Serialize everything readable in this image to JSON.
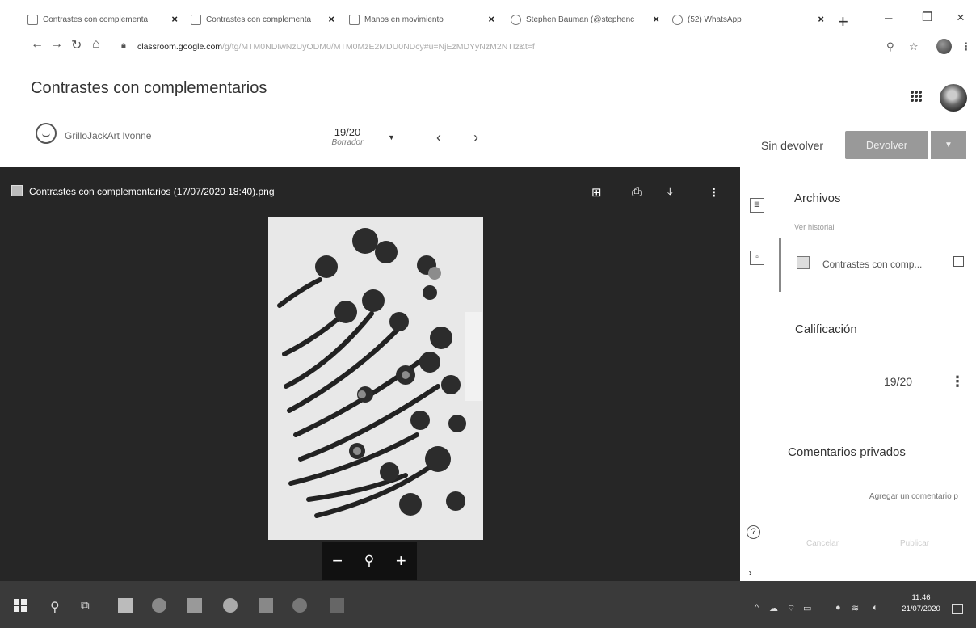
{
  "tabs": [
    {
      "title": "Contrastes con complementa"
    },
    {
      "title": "Contrastes con complementa"
    },
    {
      "title": "Manos en movimiento"
    },
    {
      "title": "Stephen Bauman (@stephenc"
    },
    {
      "title": "(52) WhatsApp"
    }
  ],
  "addressbar": {
    "domain": "classroom.google.com",
    "path": "/g/tg/MTM0NDIwNzUyODM0/MTM0MzE2MDU0NDcy#u=NjEzMDYyNzM2NTIz&t=f"
  },
  "page": {
    "title": "Contrastes con complementarios"
  },
  "student": {
    "name": "GrilloJackArt Ivonne",
    "grade": "19/20",
    "grade_status": "Borrador"
  },
  "actions": {
    "sin_devolver": "Sin devolver",
    "devolver": "Devolver"
  },
  "viewer": {
    "file_title": "Contrastes con complementarios (17/07/2020 18:40).png"
  },
  "panel": {
    "archivos": "Archivos",
    "ver_historial": "Ver historial",
    "file_name": "Contrastes con comp...",
    "calificacion": "Calificación",
    "grade": "19/20",
    "comentarios": "Comentarios privados",
    "comment_placeholder": "Agregar un comentario p",
    "cancel": "Cancelar",
    "publish": "Publicar"
  },
  "taskbar": {
    "time": "11:46",
    "date": "21/07/2020"
  },
  "colors": {
    "viewer_bg": "#262626",
    "devolver_button": "#999999",
    "taskbar": "#3a3a3a"
  }
}
